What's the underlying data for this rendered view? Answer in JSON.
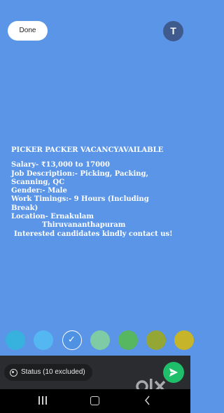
{
  "header": {
    "done_label": "Done",
    "avatar_letter": "T"
  },
  "post": {
    "lines": [
      "PICKER PACKER VACANCYAVAILABLE",
      "",
      " Salary- ₹13,000 to 17000",
      "Job Description:- Picking, Packing,",
      "Scanning, QC",
      "Gender:- Male",
      "Work Timings:- 9 Hours (Including",
      "Break)",
      "Location- Ernakulam",
      "Thiruvananthapuram",
      " Interested candidates kindly contact us!"
    ]
  },
  "palette": {
    "colors": [
      "#37b2df",
      "#55b7f2",
      "#4f92e4",
      "#7ecba5",
      "#57b761",
      "#94a634",
      "#c6b52a"
    ],
    "selected_index": 2
  },
  "bottom": {
    "status_label": "Status (10 excluded)",
    "send_icon": "send-icon"
  },
  "watermark": {
    "text": "OLX"
  },
  "colors": {
    "background": "#5b95e7",
    "send": "#1ebe6a",
    "bar": "#2a2c2f"
  }
}
